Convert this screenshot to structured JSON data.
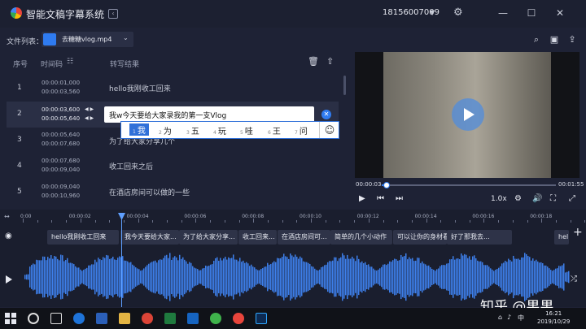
{
  "app": {
    "title": "智能文稿字幕系统",
    "account": "18156007009"
  },
  "file": {
    "label": "文件列表：",
    "name": "去糖糖vlog.mp4"
  },
  "table": {
    "headers": {
      "index": "序号",
      "time": "时间码",
      "text": "转写结果"
    },
    "rows": [
      {
        "index": "1",
        "start": "00:00:01,000",
        "end": "00:00:03,560",
        "text": "hello我刚收工回来"
      },
      {
        "index": "2",
        "start": "00:00:03,600",
        "end": "00:00:05,640",
        "text": "我w今天要给大家录我的第一支Vlog"
      },
      {
        "index": "3",
        "start": "00:00:05,640",
        "end": "00:00:07,680",
        "text": "为了给大家分享几个"
      },
      {
        "index": "4",
        "start": "00:00:07,680",
        "end": "00:00:09,040",
        "text": "收工回来之后"
      },
      {
        "index": "5",
        "start": "00:00:09,040",
        "end": "00:00:10,960",
        "text": "在酒店房间可以做的一些"
      }
    ]
  },
  "ime": {
    "candidates": [
      {
        "n": "1",
        "w": "我"
      },
      {
        "n": "2",
        "w": "为"
      },
      {
        "n": "3",
        "w": "五"
      },
      {
        "n": "4",
        "w": "玩"
      },
      {
        "n": "5",
        "w": "哇"
      },
      {
        "n": "6",
        "w": "王"
      },
      {
        "n": "7",
        "w": "问"
      }
    ],
    "emoji": "☺"
  },
  "player": {
    "current": "00:00:03",
    "duration": "00:01:55",
    "progress": 0.026,
    "speed": "1.0x"
  },
  "timeline": {
    "ticks": [
      "0:00",
      "00:00:02",
      "00:00:04",
      "00:00:06",
      "00:00:08",
      "00:00:10",
      "00:00:12",
      "00:00:14",
      "00:00:16",
      "00:00:18"
    ],
    "segments": [
      "hello我刚收工回来",
      "我今天要给大家...",
      "为了给大家分享...",
      "收工回来...",
      "在酒店房间可...",
      "简单的几个小动作",
      "可以让你的身材看起来...",
      "好了那我去...",
      "hel"
    ]
  },
  "watermark": "知乎 @果果",
  "taskbar": {
    "time": "16:21",
    "date": "2019/10/29",
    "ime": "中"
  },
  "colors": {
    "accent": "#2f7bf0",
    "background": "#1e2235",
    "waveform": "#3d7fea"
  }
}
